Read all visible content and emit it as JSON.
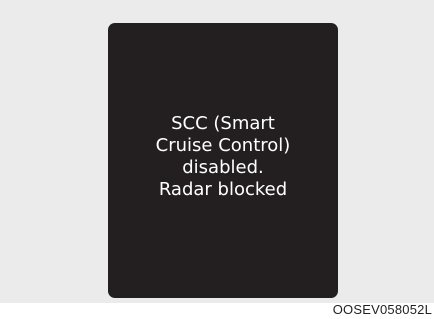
{
  "display": {
    "message_lines": [
      "SCC (Smart",
      "Cruise Control)",
      "disabled.",
      "Radar blocked"
    ]
  },
  "image_code": "OOSEV058052L",
  "colors": {
    "background": "#ebebeb",
    "screen": "#231f20",
    "text": "#ffffff"
  }
}
